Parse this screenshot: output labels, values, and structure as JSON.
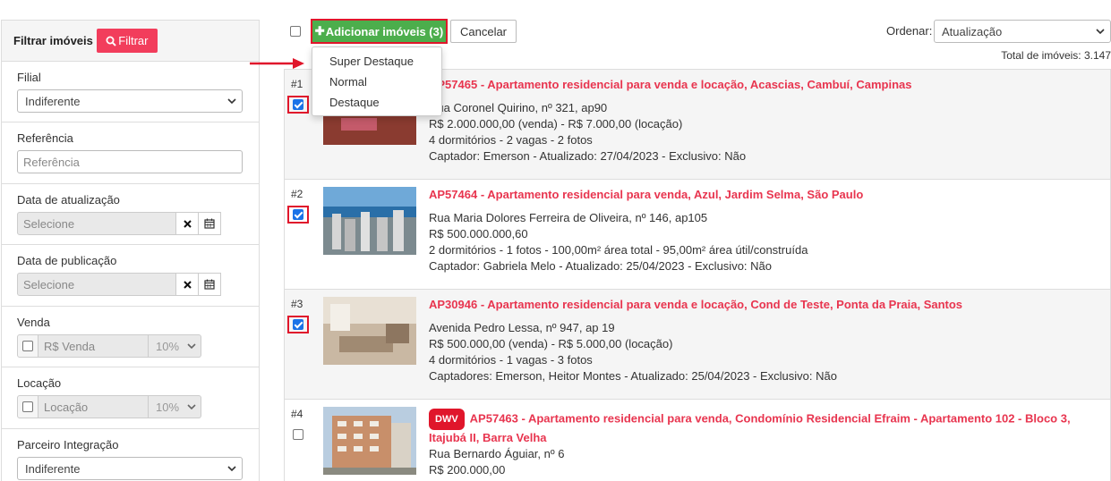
{
  "sidebar": {
    "title": "Filtrar imóveis",
    "filter_button": "Filtrar",
    "filial": {
      "label": "Filial",
      "value": "Indiferente"
    },
    "referencia": {
      "label": "Referência",
      "placeholder": "Referência"
    },
    "data_atualizacao": {
      "label": "Data de atualização",
      "placeholder": "Selecione"
    },
    "data_publicacao": {
      "label": "Data de publicação",
      "placeholder": "Selecione"
    },
    "venda": {
      "label": "Venda",
      "placeholder": "R$ Venda",
      "pct": "10%"
    },
    "locacao": {
      "label": "Locação",
      "placeholder": "Locação",
      "pct": "10%"
    },
    "parceiro": {
      "label": "Parceiro Integração",
      "value": "Indiferente"
    }
  },
  "toolbar": {
    "add_label": "Adicionar imóveis (3)",
    "cancel_label": "Cancelar",
    "order_label": "Ordenar:",
    "order_value": "Atualização",
    "total": "Total de imóveis: 3.147"
  },
  "menu": {
    "items": [
      "Super Destaque",
      "Normal",
      "Destaque"
    ]
  },
  "listings": [
    {
      "num": "#1",
      "checked": true,
      "title": "AP57465 - Apartamento residencial para venda e locação, Acascias, Cambuí, Campinas",
      "address": "Rua Coronel Quirino, nº 321, ap90",
      "price": "R$ 2.000.000,00 (venda) - R$ 7.000,00 (locação)",
      "details": "4 dormitórios - 2 vagas - 2 fotos",
      "meta": "Captador: Emerson - Atualizado: 27/04/2023 - Exclusivo: Não"
    },
    {
      "num": "#2",
      "checked": true,
      "title": "AP57464 - Apartamento residencial para venda, Azul, Jardim Selma, São Paulo",
      "address": "Rua Maria Dolores Ferreira de Oliveira, nº 146, ap105",
      "price": "R$ 500.000.000,60",
      "details": "2 dormitórios - 1 fotos - 100,00m² área total - 95,00m² área útil/construída",
      "meta": "Captador: Gabriela Melo - Atualizado: 25/04/2023 - Exclusivo: Não"
    },
    {
      "num": "#3",
      "checked": true,
      "title": "AP30946 - Apartamento residencial para venda e locação, Cond de Teste, Ponta da Praia, Santos",
      "address": "Avenida Pedro Lessa, nº 947, ap 19",
      "price": "R$ 500.000,00 (venda) - R$ 5.000,00 (locação)",
      "details": "4 dormitórios - 1 vagas - 3 fotos",
      "meta": "Captadores: Emerson, Heitor Montes - Atualizado: 25/04/2023 - Exclusivo: Não"
    },
    {
      "num": "#4",
      "checked": false,
      "badge": "DWV",
      "title": "AP57463 - Apartamento residencial para venda, Condomínio Residencial Efraim - Apartamento 102 - Bloco 3,",
      "title2": "Itajubá II, Barra Velha",
      "address": "Rua Bernardo Águiar, nº 6",
      "price": "R$ 200.000,00"
    }
  ],
  "colors": {
    "accent_red": "#f23d5c",
    "title_red": "#e8354f",
    "green": "#4cae4c",
    "highlight": "#e0162b"
  }
}
